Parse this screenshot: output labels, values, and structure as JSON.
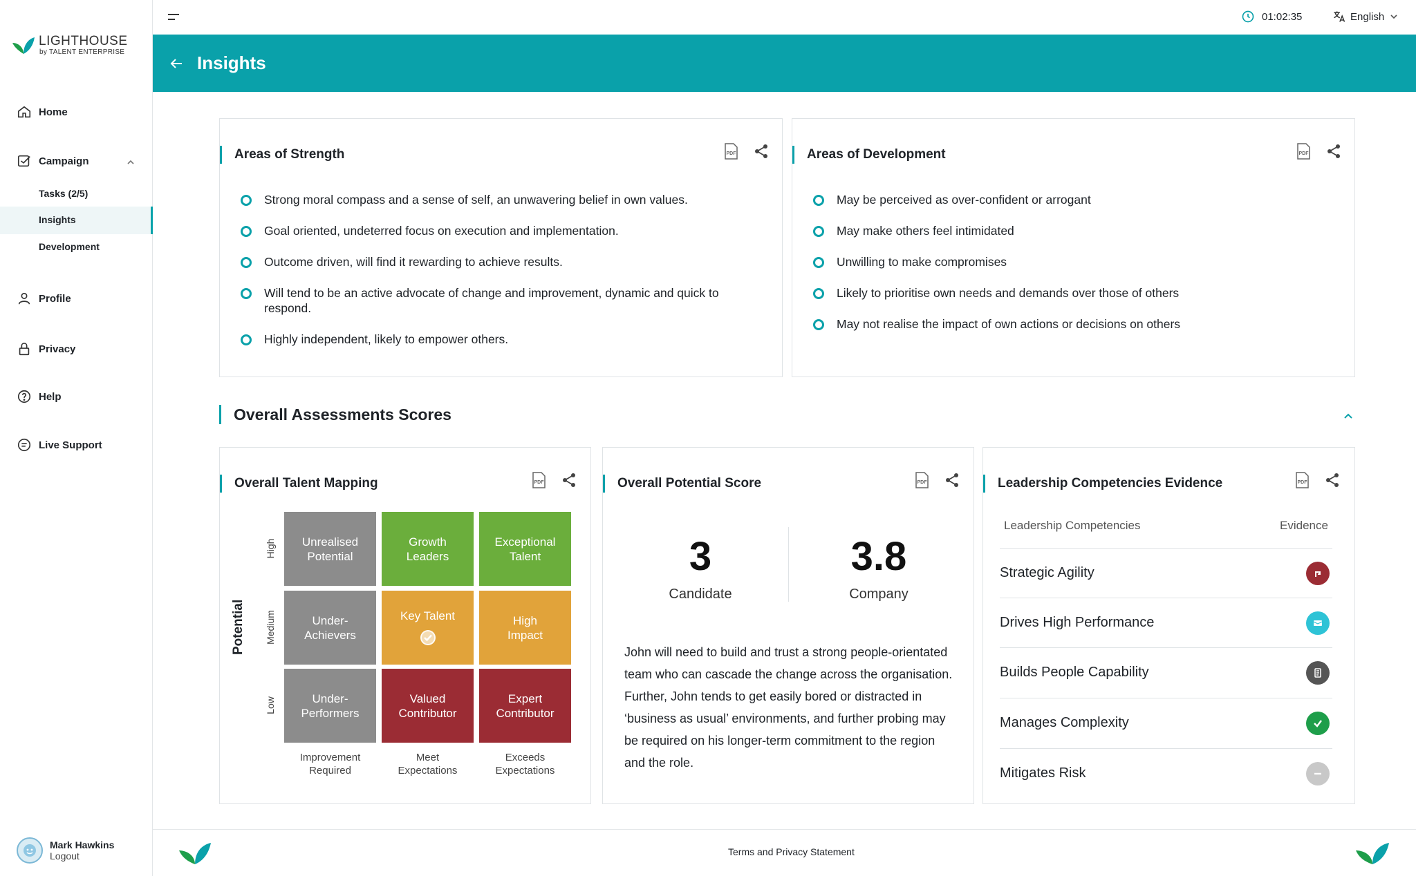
{
  "brand": {
    "name": "LIGHTHOUSE",
    "sub": "by TALENT ENTERPRISE"
  },
  "sidebar": {
    "items": [
      {
        "label": "Home",
        "icon": "home-icon"
      },
      {
        "label": "Campaign",
        "icon": "campaign-icon"
      },
      {
        "label": "Profile",
        "icon": "user-icon"
      },
      {
        "label": "Privacy",
        "icon": "lock-icon"
      },
      {
        "label": "Help",
        "icon": "help-icon"
      },
      {
        "label": "Live Support",
        "icon": "chat-icon"
      }
    ],
    "campaign_sub": [
      "Tasks (2/5)",
      "Insights",
      "Development"
    ]
  },
  "user": {
    "name": "Mark Hawkins",
    "logout": "Logout"
  },
  "topbar": {
    "timer": "01:02:35",
    "language": "English"
  },
  "header": {
    "title": "Insights"
  },
  "strength": {
    "title": "Areas of Strength",
    "items": [
      "Strong moral compass and a sense  of self, an unwavering belief in own values.",
      "Goal oriented, undeterred focus on execution and implementation.",
      "Outcome driven, will find it rewarding to achieve results.",
      "Will tend to be an active advocate of change and improvement, dynamic and quick to respond.",
      "Highly independent, likely to empower others."
    ]
  },
  "development": {
    "title": "Areas of Development",
    "items": [
      "May be perceived as over-confident or arrogant",
      "May make others feel intimidated",
      "Unwilling to make compromises",
      "Likely to prioritise own needs and demands over those of others",
      "May not realise the impact of own actions or decisions on others"
    ]
  },
  "section": {
    "title": "Overall Assessments Scores"
  },
  "talent": {
    "title": "Overall Talent Mapping",
    "y_label": "Potential",
    "y_ticks": [
      "High",
      "Medium",
      "Low"
    ],
    "x_ticks": [
      "Improvement Required",
      "Meet Expectations",
      "Exceeds Expectations"
    ],
    "cells": [
      [
        "Unrealised Potential",
        "Growth Leaders",
        "Exceptional Talent"
      ],
      [
        "Under-Achievers",
        "Key Talent",
        "High Impact"
      ],
      [
        "Under-Performers",
        "Valued Contributor",
        "Expert Contributor"
      ]
    ],
    "selected": "Key Talent"
  },
  "potential": {
    "title": "Overall Potential Score",
    "candidate_value": "3",
    "candidate_label": "Candidate",
    "company_value": "3.8",
    "company_label": "Company",
    "text": "John will need to build and trust a strong people-orientated team who can cascade the change across the organisation. Further, John tends to get easily bored or distracted in ‘business as usual’ environments, and further probing may be required on his longer-term commitment to the region and the role."
  },
  "leadership": {
    "title": "Leadership Competencies Evidence",
    "col1": "Leadership Competencies",
    "col2": "Evidence",
    "rows": [
      {
        "label": "Strategic Agility",
        "color": "#9b2c34",
        "icon": "link-icon"
      },
      {
        "label": "Drives High Performance",
        "color": "#2ec3d6",
        "icon": "card-icon"
      },
      {
        "label": "Builds People Capability",
        "color": "#555555",
        "icon": "document-icon"
      },
      {
        "label": "Manages Complexity",
        "color": "#1e9e4a",
        "icon": "check-icon"
      },
      {
        "label": "Mitigates Risk",
        "color": "#c8c8c8",
        "icon": "minus-icon"
      }
    ]
  },
  "footer": {
    "link": "Terms and Privacy Statement"
  },
  "colors": {
    "accent": "#0aa1aa"
  }
}
